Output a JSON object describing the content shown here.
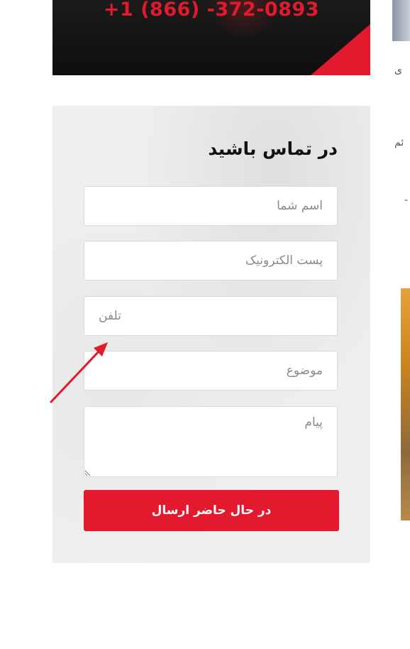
{
  "banner": {
    "phone": "+1 (866) -372-0893"
  },
  "side_column": {
    "snippet_1": "ی",
    "snippet_2": "ئم",
    "snippet_3": "-"
  },
  "contact_form": {
    "title": "در تماس باشید",
    "name_placeholder": "اسم شما",
    "email_placeholder": "پست الکترونیک",
    "phone_placeholder": "تلفن",
    "subject_placeholder": "موضوع",
    "message_placeholder": "پیام",
    "submit_label": "در حال حاضر ارسال"
  },
  "colors": {
    "accent": "#e3192d",
    "panel_bg": "#efefef",
    "annotation_arrow": "#e3192d"
  }
}
